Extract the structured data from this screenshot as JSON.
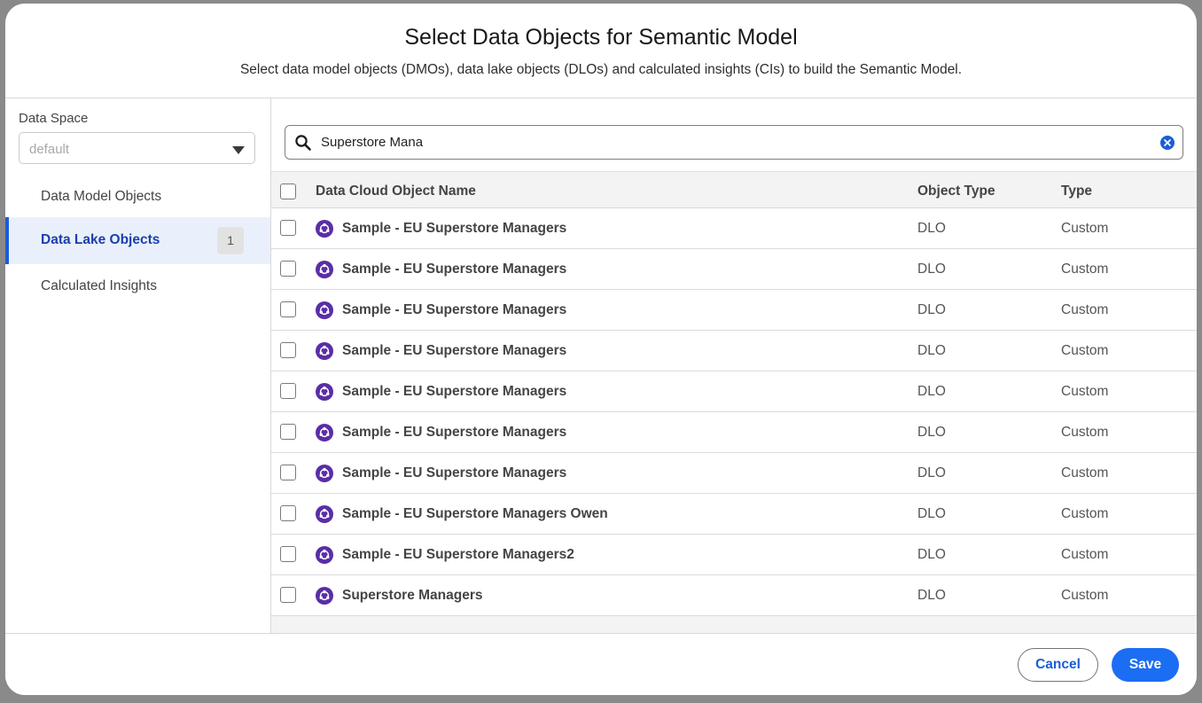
{
  "header": {
    "title": "Select Data Objects for Semantic Model",
    "subtitle": "Select data model objects (DMOs), data lake objects (DLOs) and calculated insights (CIs) to build the Semantic Model."
  },
  "sidebar": {
    "data_space_label": "Data Space",
    "data_space_value": "default",
    "items": [
      {
        "label": "Data Model Objects",
        "badge": ""
      },
      {
        "label": "Data Lake Objects",
        "badge": "1"
      },
      {
        "label": "Calculated Insights",
        "badge": ""
      }
    ]
  },
  "search": {
    "value": "Superstore Mana",
    "icon": "search-icon",
    "clear_icon": "clear-icon"
  },
  "table": {
    "columns": [
      "Data Cloud Object Name",
      "Object Type",
      "Type"
    ],
    "rows": [
      {
        "name": "Sample - EU Superstore Managers",
        "object_type": "DLO",
        "type": "Custom"
      },
      {
        "name": "Sample - EU Superstore Managers",
        "object_type": "DLO",
        "type": "Custom"
      },
      {
        "name": "Sample - EU Superstore Managers",
        "object_type": "DLO",
        "type": "Custom"
      },
      {
        "name": "Sample - EU Superstore Managers",
        "object_type": "DLO",
        "type": "Custom"
      },
      {
        "name": "Sample - EU Superstore Managers",
        "object_type": "DLO",
        "type": "Custom"
      },
      {
        "name": "Sample - EU Superstore Managers",
        "object_type": "DLO",
        "type": "Custom"
      },
      {
        "name": "Sample - EU Superstore Managers",
        "object_type": "DLO",
        "type": "Custom"
      },
      {
        "name": "Sample - EU Superstore Managers Owen",
        "object_type": "DLO",
        "type": "Custom"
      },
      {
        "name": "Sample - EU Superstore Managers2",
        "object_type": "DLO",
        "type": "Custom"
      },
      {
        "name": "Superstore Managers",
        "object_type": "DLO",
        "type": "Custom"
      }
    ]
  },
  "footer": {
    "cancel_label": "Cancel",
    "save_label": "Save"
  },
  "colors": {
    "accent": "#1b6ef3",
    "active_nav_bg": "#eaf0fb",
    "dlo_icon": "#5a2ea6"
  }
}
